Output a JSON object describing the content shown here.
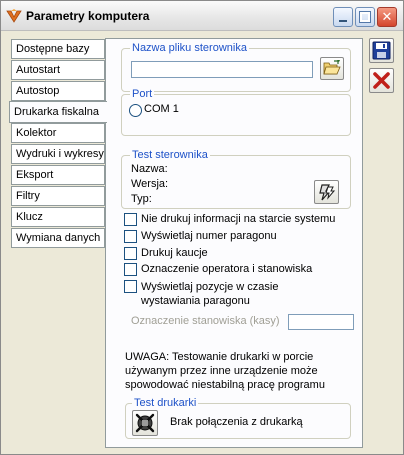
{
  "window": {
    "title": "Parametry komputera"
  },
  "tabs": [
    {
      "label": "Dostępne bazy"
    },
    {
      "label": "Autostart"
    },
    {
      "label": "Autostop"
    },
    {
      "label": "Drukarka fiskalna",
      "active": true
    },
    {
      "label": "Kolektor"
    },
    {
      "label": "Wydruki i wykresy"
    },
    {
      "label": "Eksport"
    },
    {
      "label": "Filtry"
    },
    {
      "label": "Klucz"
    },
    {
      "label": "Wymiana danych"
    }
  ],
  "driver_file": {
    "legend": "Nazwa pliku sterownika",
    "value": ""
  },
  "port": {
    "legend": "Port",
    "option_label": "COM 1"
  },
  "driver_test": {
    "legend": "Test sterownika",
    "name_label": "Nazwa:",
    "version_label": "Wersja:",
    "type_label": "Typ:"
  },
  "options": [
    {
      "label": "Nie drukuj informacji na starcie systemu",
      "checked": false
    },
    {
      "label": "Wyświetlaj numer paragonu",
      "checked": false
    },
    {
      "label": "Drukuj kaucje",
      "checked": false
    },
    {
      "label": "Oznaczenie operatora i stanowiska",
      "checked": false
    },
    {
      "label_line1": "Wyświetlaj pozycje w czasie",
      "label_line2": "wystawiania paragonu",
      "checked": false
    }
  ],
  "station_mark": {
    "label": "Oznaczenie stanowiska (kasy)",
    "value": ""
  },
  "warning": {
    "line1": "UWAGA: Testowanie drukarki w porcie",
    "line2": "używanym przez inne urządzenie może",
    "line3": "spowodować niestabilną pracę programu"
  },
  "printer_test": {
    "legend": "Test drukarki",
    "status": "Brak połączenia z drukarką"
  },
  "colors": {
    "legend_text": "#1e52c8",
    "save_icon": "#1f3f9a",
    "cancel_icon": "#c0201a",
    "app_icon": "#e07020"
  },
  "icons": {
    "folder": "folder-open-icon",
    "lightning": "lightning-icon",
    "printer_test": "disconnected-icon",
    "save": "floppy-disk-icon",
    "cancel": "red-x-icon"
  }
}
